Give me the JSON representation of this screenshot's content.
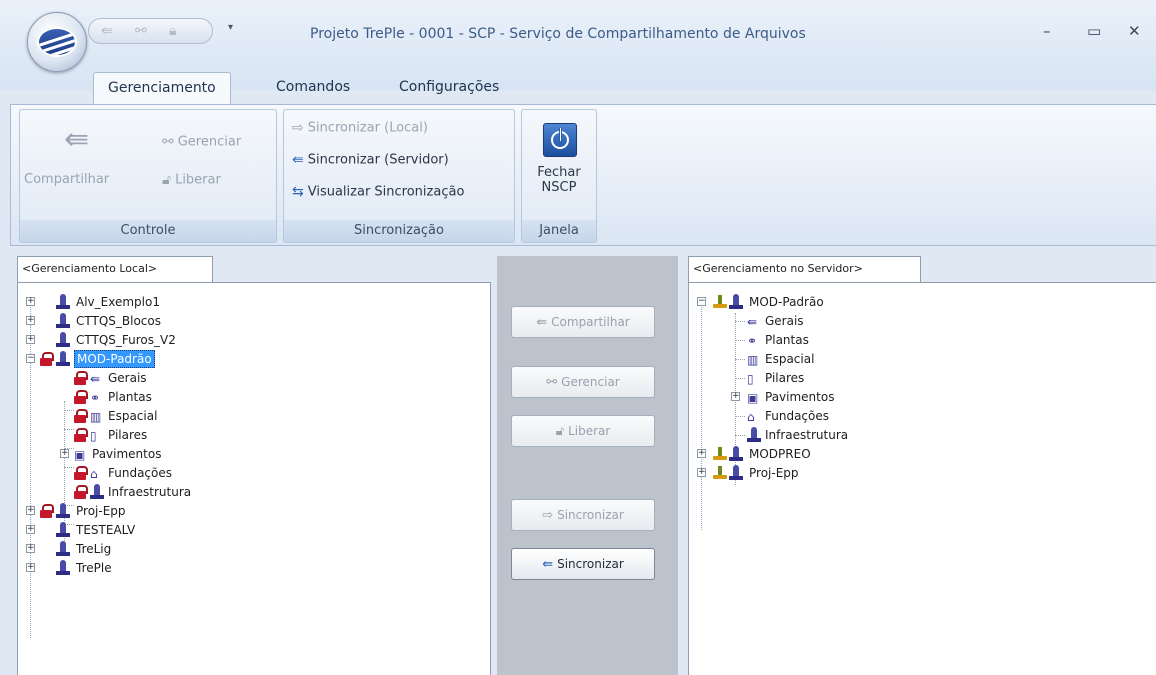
{
  "window": {
    "title": "Projeto TrePle - 0001 - SCP - Serviço de Compartilhamento de Arquivos",
    "minimize_glyph": "–",
    "maximize_glyph": "▭",
    "close_glyph": "✕"
  },
  "tabs": [
    "Gerenciamento",
    "Comandos",
    "Configurações"
  ],
  "ribbon": {
    "controle": {
      "label": "Controle",
      "compartilhar": "Compartilhar",
      "gerenciar": "Gerenciar",
      "liberar": "Liberar"
    },
    "sincronizacao": {
      "label": "Sincronização",
      "sinc_local": "Sincronizar (Local)",
      "sinc_servidor": "Sincronizar (Servidor)",
      "visualizar": "Visualizar Sincronização"
    },
    "janela": {
      "label": "Janela",
      "fechar_line1": "Fechar",
      "fechar_line2": "NSCP"
    }
  },
  "left_panel": {
    "tab_label": "<Gerenciamento Local>",
    "items": {
      "alv": "Alv_Exemplo1",
      "blocos": "CTTQS_Blocos",
      "furos": "CTTQS_Furos_V2",
      "mod": "MOD-Padrão",
      "gerais": "Gerais",
      "plantas": "Plantas",
      "espacial": "Espacial",
      "pilares": "Pilares",
      "pavimentos": "Pavimentos",
      "fundacoes": "Fundações",
      "infra": "Infraestrutura",
      "projepp": "Proj-Epp",
      "testealv": "TESTEALV",
      "trelig": "TreLig",
      "treple": "TrePle"
    }
  },
  "middle": {
    "compartilhar": "Compartilhar",
    "gerenciar": "Gerenciar",
    "liberar": "Liberar",
    "sinc_local": "Sincronizar",
    "sinc_servidor": "Sincronizar"
  },
  "right_panel": {
    "tab_label": "<Gerenciamento no Servidor>",
    "items": {
      "mod": "MOD-Padrão",
      "gerais": "Gerais",
      "plantas": "Plantas",
      "espacial": "Espacial",
      "pilares": "Pilares",
      "pavimentos": "Pavimentos",
      "fundacoes": "Fundações",
      "infra": "Infraestrutura",
      "modpreo": "MODPREO",
      "projepp": "Proj-Epp"
    }
  },
  "colors": {
    "selection": "#3399ff",
    "lock": "#c4182a",
    "title_text": "#3e5b87"
  }
}
